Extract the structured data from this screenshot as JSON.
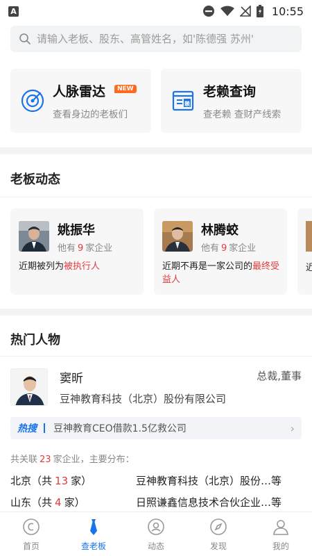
{
  "status_bar": {
    "app_badge": "A",
    "time": "10:55"
  },
  "search": {
    "placeholder": "请输入老板、股东、高管姓名，如'陈德强 苏州'"
  },
  "features": [
    {
      "title": "人脉雷达",
      "badge": "NEW",
      "subtitle": "查看身边的老板们",
      "icon": "radar-icon"
    },
    {
      "title": "老赖查询",
      "subtitle": "查老赖 查财产线索",
      "icon": "debtor-icon"
    }
  ],
  "boss_section": {
    "title": "老板动态",
    "cards": [
      {
        "name": "姚振华",
        "meta_prefix": "他有",
        "count": "9",
        "meta_suffix": "家企业",
        "desc_plain": "近期被列为",
        "desc_highlight": "被执行人"
      },
      {
        "name": "林腾蛟",
        "meta_prefix": "他有",
        "count": "9",
        "meta_suffix": "家企业",
        "desc_plain": "近期不再是一家公司的",
        "desc_highlight": "最终受益人"
      },
      {
        "desc_plain": "近"
      }
    ]
  },
  "hot_section": {
    "title": "热门人物",
    "person": {
      "name": "窦昕",
      "position": "总裁,董事",
      "company": "豆神教育科技（北京）股份有限公司"
    },
    "hot_search": {
      "tag": "热搜",
      "text": "豆神教育CEO借款1.5亿救公司"
    },
    "association": {
      "prefix": "共关联",
      "count": "23",
      "suffix": "家企业，主要分布："
    },
    "distribution": [
      {
        "region": "北京",
        "open": "（共",
        "count": "13",
        "close": "家）",
        "firm": "豆神教育科技（北京）股份…等"
      },
      {
        "region": "山东",
        "open": "（共",
        "count": "4",
        "close": "家）",
        "firm": "日照谦鑫信息技术合伙企业…等"
      }
    ]
  },
  "bottom_nav": [
    {
      "label": "首页",
      "icon": "home-icon",
      "active": false
    },
    {
      "label": "查老板",
      "icon": "tie-icon",
      "active": true
    },
    {
      "label": "动态",
      "icon": "feed-icon",
      "active": false
    },
    {
      "label": "发现",
      "icon": "compass-icon",
      "active": false
    },
    {
      "label": "我的",
      "icon": "profile-icon",
      "active": false
    }
  ],
  "colors": {
    "accent": "#1a73e8",
    "highlight": "#e23b3b",
    "badge": "#ff6a1f"
  }
}
